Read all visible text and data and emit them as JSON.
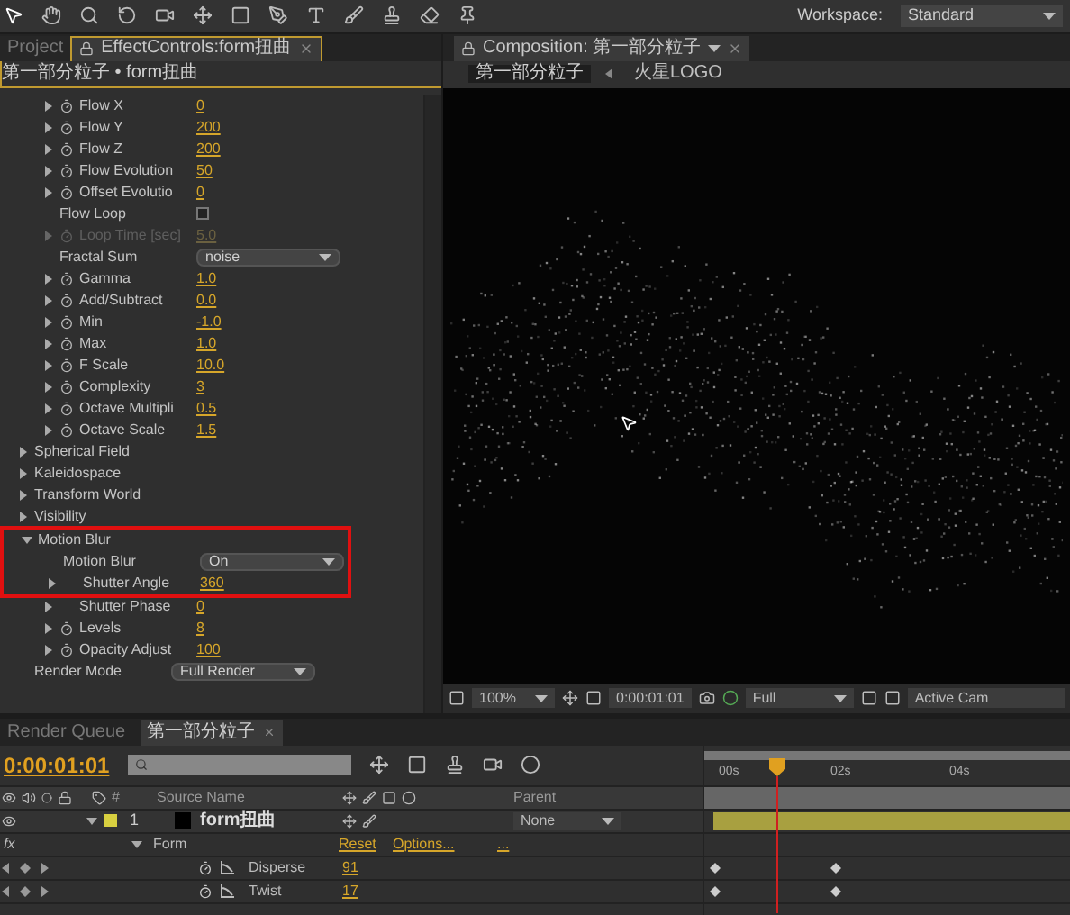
{
  "toolbar": {
    "workspace_label": "Workspace:",
    "workspace": "Standard"
  },
  "left_panel": {
    "tabs": [
      {
        "label": "Project",
        "selected": false
      },
      {
        "label": "EffectControls:form扭曲",
        "selected": true
      }
    ],
    "breadcrumb": "第一部分粒子 • form扭曲",
    "params": [
      {
        "kind": "param",
        "label": "Flow X",
        "value": "0",
        "stopwatch": true,
        "disabled": false
      },
      {
        "kind": "param",
        "label": "Flow Y",
        "value": "200",
        "stopwatch": true,
        "disabled": false
      },
      {
        "kind": "param",
        "label": "Flow Z",
        "value": "200",
        "stopwatch": true,
        "disabled": false
      },
      {
        "kind": "param",
        "label": "Flow Evolution",
        "value": "50",
        "stopwatch": true,
        "disabled": false
      },
      {
        "kind": "param",
        "label": "Offset Evolutio",
        "value": "0",
        "stopwatch": true,
        "disabled": false
      },
      {
        "kind": "checkbox",
        "label": "Flow Loop",
        "checked": false,
        "disabled": false
      },
      {
        "kind": "param",
        "label": "Loop Time [sec]",
        "value": "5.0",
        "stopwatch": true,
        "disabled": true
      },
      {
        "kind": "dropdown",
        "label": "Fractal Sum",
        "value": "noise"
      },
      {
        "kind": "param",
        "label": "Gamma",
        "value": "1.0",
        "stopwatch": true,
        "disabled": false
      },
      {
        "kind": "param",
        "label": "Add/Subtract",
        "value": "0.0",
        "stopwatch": true,
        "disabled": false
      },
      {
        "kind": "param",
        "label": "Min",
        "value": "-1.0",
        "stopwatch": true,
        "disabled": false
      },
      {
        "kind": "param",
        "label": "Max",
        "value": "1.0",
        "stopwatch": true,
        "disabled": false
      },
      {
        "kind": "param",
        "label": "F Scale",
        "value": "10.0",
        "stopwatch": true,
        "disabled": false
      },
      {
        "kind": "param",
        "label": "Complexity",
        "value": "3",
        "stopwatch": true,
        "disabled": false
      },
      {
        "kind": "param",
        "label": "Octave Multipli",
        "value": "0.5",
        "stopwatch": true,
        "disabled": false
      },
      {
        "kind": "param",
        "label": "Octave Scale",
        "value": "1.5",
        "stopwatch": true,
        "disabled": false
      }
    ],
    "groups": [
      {
        "kind": "group",
        "label": "Spherical Field",
        "expanded": false,
        "highlighted": false
      },
      {
        "kind": "group",
        "label": "Kaleidospace",
        "expanded": false,
        "highlighted": false
      },
      {
        "kind": "group",
        "label": "Transform World",
        "expanded": false,
        "highlighted": false
      },
      {
        "kind": "group",
        "label": "Visibility",
        "expanded": false,
        "highlighted": false
      },
      {
        "kind": "group",
        "label": "Motion Blur",
        "expanded": true,
        "highlighted": true,
        "children": [
          {
            "kind": "dropdown",
            "label": "Motion Blur",
            "value": "On",
            "highlighted": true
          },
          {
            "kind": "param",
            "label": "Shutter Angle",
            "value": "360",
            "stopwatch": false,
            "disabled": false,
            "highlighted": true
          },
          {
            "kind": "param",
            "label": "Shutter Phase",
            "value": "0",
            "stopwatch": false,
            "disabled": false,
            "highlighted": false
          },
          {
            "kind": "param",
            "label": "Levels",
            "value": "8",
            "stopwatch": true,
            "disabled": false,
            "highlighted": false
          },
          {
            "kind": "param",
            "label": "Opacity Adjust",
            "value": "100",
            "stopwatch": true,
            "disabled": false,
            "highlighted": false
          }
        ]
      },
      {
        "kind": "dropdown",
        "label": "Render Mode",
        "value": "Full Render"
      }
    ]
  },
  "composition": {
    "tab": "Composition: 第一部分粒子",
    "breadcrumbs": [
      "第一部分粒子",
      "火星LOGO"
    ],
    "footer": {
      "zoom": "100%",
      "timecode": "0:00:01:01",
      "resolution": "Full",
      "camera": "Active Cam"
    }
  },
  "timeline": {
    "tabs": [
      {
        "label": "Render Queue",
        "selected": false
      },
      {
        "label": "第一部分粒子",
        "selected": true
      }
    ],
    "timecode": "0:00:01:01",
    "columns": [
      "#",
      "Source Name",
      "Parent"
    ],
    "layer": {
      "number": "1",
      "name": "form扭曲",
      "color": "#d8d040",
      "parent": "None"
    },
    "effect": {
      "fx": "fx",
      "name": "Form",
      "reset": "Reset",
      "options": "Options...",
      "more": "..."
    },
    "properties": [
      {
        "name": "Disperse",
        "value": "91"
      },
      {
        "name": "Twist",
        "value": "17"
      }
    ],
    "ruler": [
      "00s",
      "02s",
      "04s"
    ]
  }
}
